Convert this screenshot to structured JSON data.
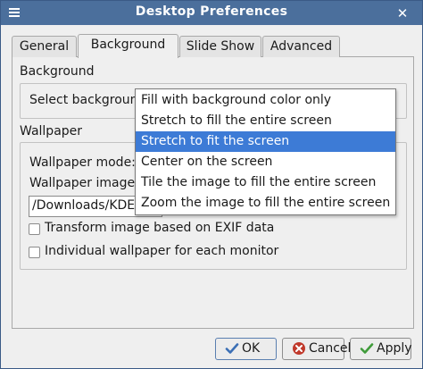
{
  "window": {
    "title": "Desktop Preferences"
  },
  "tabs": [
    {
      "label": "General"
    },
    {
      "label": "Background"
    },
    {
      "label": "Slide Show"
    },
    {
      "label": "Advanced"
    }
  ],
  "background_section": {
    "heading": "Background",
    "select_label": "Select background"
  },
  "wallpaper_section": {
    "heading": "Wallpaper",
    "mode_label": "Wallpaper mode:",
    "image_label": "Wallpaper image file:",
    "path_value": "/Downloads/KDE_Plasma",
    "exif_label": "Transform image based on EXIF data",
    "exif_checked": false,
    "per_monitor_label": "Individual wallpaper for each monitor",
    "per_monitor_checked": false
  },
  "dropdown": {
    "selected_index": 2,
    "options": [
      "Fill with background color only",
      "Stretch to fill the entire screen",
      "Stretch to fit the screen",
      "Center on the screen",
      "Tile the image to fill the entire screen",
      "Zoom the image to fill the entire screen"
    ]
  },
  "buttons": {
    "ok_label": "OK",
    "cancel_label": "Cancel",
    "apply_label": "Apply"
  },
  "colors": {
    "titlebar": "#4b6f9c",
    "selection": "#3d7bd6",
    "ok_icon": "#3b6fb5",
    "cancel_icon": "#c0392b",
    "apply_icon": "#3f9b3a"
  }
}
